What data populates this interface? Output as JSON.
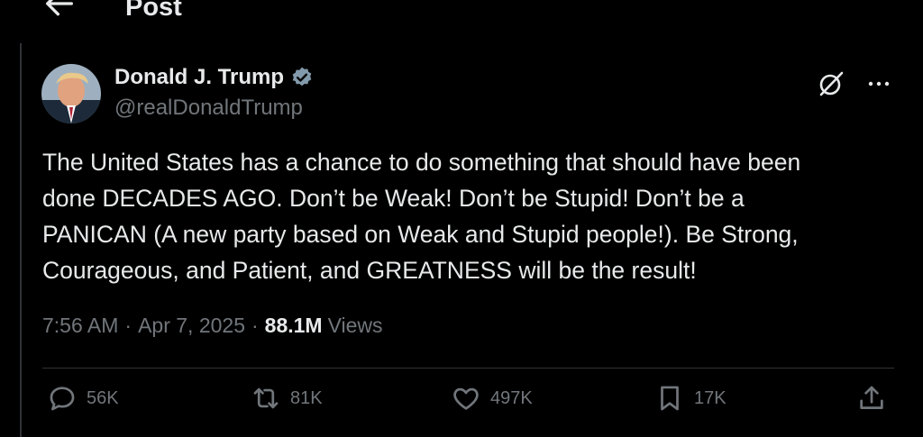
{
  "header": {
    "title": "Post"
  },
  "author": {
    "name": "Donald J. Trump",
    "handle": "@realDonaldTrump"
  },
  "post": {
    "text": "The United States has a chance to do something that should have been\ndone DECADES AGO. Don’t be Weak! Don’t be Stupid! Don’t be a\nPANICAN (A new party based on Weak and Stupid people!). Be Strong,\nCourageous, and Patient, and GREATNESS will be the result!",
    "time": "7:56 AM",
    "date": "Apr 7, 2025",
    "separator": "·",
    "views_count": "88.1M",
    "views_label": "Views"
  },
  "actions": {
    "replies": "56K",
    "reposts": "81K",
    "likes": "497K",
    "bookmarks": "17K"
  },
  "colors": {
    "background": "#000000",
    "text": "#e7e9ea",
    "secondary": "#71767b",
    "border": "#2f3336",
    "verified": "#829aab"
  },
  "icons": [
    "back-arrow-icon",
    "verified-badge-icon",
    "grok-icon",
    "more-icon",
    "reply-icon",
    "repost-icon",
    "like-icon",
    "bookmark-icon",
    "share-icon"
  ]
}
